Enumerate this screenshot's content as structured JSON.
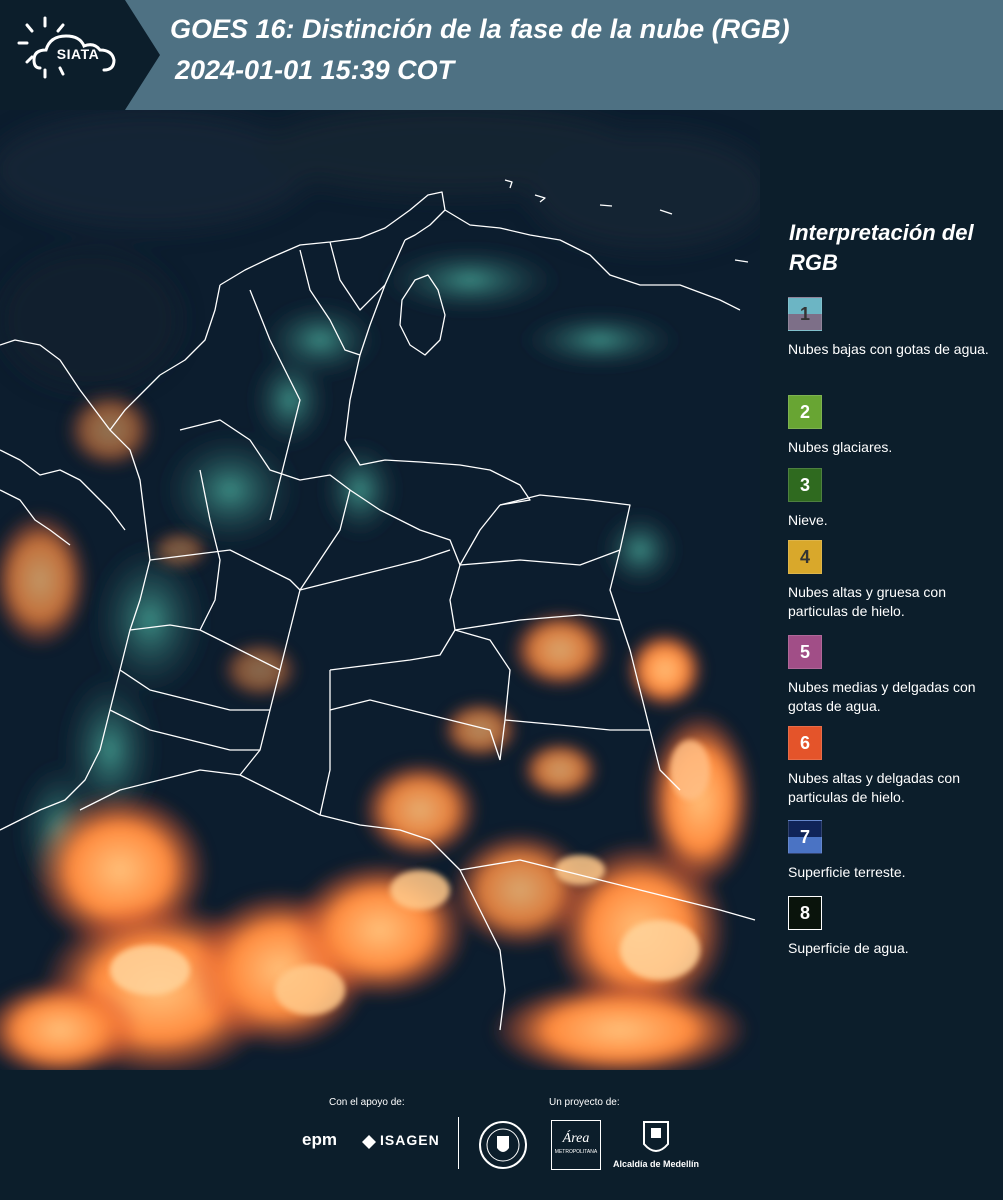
{
  "header": {
    "logo_label": "SIATA",
    "title_line1": "GOES 16: Distinción de la fase de la nube (RGB)",
    "title_line2": "2024-01-01 15:39 COT"
  },
  "legend": {
    "title": "Interpretación del RGB",
    "items": [
      {
        "number": "1",
        "label": "Nubes bajas con gotas de agua.",
        "color_top": "#6cb5c4",
        "color_bottom": "#7d6f88",
        "number_color": "#333333"
      },
      {
        "number": "2",
        "label": "Nubes glaciares.",
        "color_top": "#68a533",
        "color_bottom": "#68a533",
        "number_color": "#ffffff"
      },
      {
        "number": "3",
        "label": "Nieve.",
        "color_top": "#2f6a1f",
        "color_bottom": "#2f6a1f",
        "number_color": "#ffffff"
      },
      {
        "number": "4",
        "label": "Nubes altas y gruesa con particulas de hielo.",
        "color_top": "#d9a82b",
        "color_bottom": "#d9a82b",
        "number_color": "#333333"
      },
      {
        "number": "5",
        "label": "Nubes medias y delgadas con gotas de agua.",
        "color_top": "#a14e87",
        "color_bottom": "#a14e87",
        "number_color": "#ffffff"
      },
      {
        "number": "6",
        "label": "Nubes altas y delgadas con particulas de hielo.",
        "color_top": "#e4542a",
        "color_bottom": "#e4542a",
        "number_color": "#ffffff"
      },
      {
        "number": "7",
        "label": "Superficie terreste.",
        "color_top": "#102458",
        "color_bottom": "#4a73c4",
        "number_color": "#ffffff"
      },
      {
        "number": "8",
        "label": "Superficie de agua.",
        "color_top": "#0a140c",
        "color_bottom": "#0a140c",
        "number_color": "#ffffff"
      }
    ]
  },
  "footer": {
    "support_label": "Con el apoyo de:",
    "project_label": "Un proyecto de:",
    "epm_logo": "epm",
    "isagen_logo": "ISAGEN",
    "area_logo": "Área",
    "area_subtitle": "METROPOLITANA",
    "alcaldia_logo": "Alcaldía de Medellín"
  },
  "colors": {
    "header_bg": "#4e7183",
    "panel_bg": "#0c1e2b",
    "cloud_orange": "#ff8a3d",
    "land_dark": "#0e2236"
  }
}
